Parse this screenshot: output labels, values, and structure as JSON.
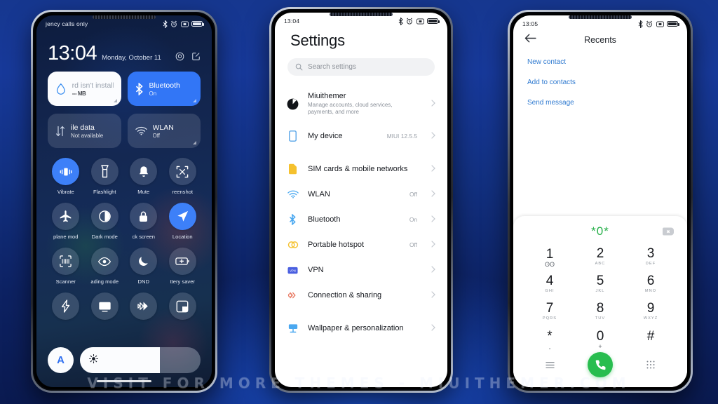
{
  "watermark": "VISIT FOR MORE THEMES - MIUITHEMER.COM",
  "background_color": "#123080",
  "phone1": {
    "name": "control-center",
    "status": {
      "carrier": "jency calls only",
      "icons": [
        "bluetooth-icon",
        "alarm-icon",
        "vibrate-icon",
        "battery-icon"
      ]
    },
    "clock": {
      "time": "13:04",
      "date": "Monday, October 11"
    },
    "header_icons": [
      "settings-gear-icon",
      "edit-icon"
    ],
    "big_tiles": [
      {
        "title": "rd isn't install",
        "sub": "--- MB",
        "state": "light",
        "icon": "water-drop-icon"
      },
      {
        "title": "Bluetooth",
        "sub": "On",
        "state": "on",
        "icon": "bluetooth-icon"
      },
      {
        "title": "ile data",
        "sub": "Not available",
        "state": "off",
        "icon": "mobile-data-icon"
      },
      {
        "title": "WLAN",
        "sub": "Off",
        "state": "off",
        "icon": "wifi-icon"
      }
    ],
    "toggles": [
      {
        "label": "Vibrate",
        "icon": "vibrate-icon",
        "active": true
      },
      {
        "label": "Flashlight",
        "icon": "flashlight-icon",
        "active": false
      },
      {
        "label": "Mute",
        "icon": "bell-icon",
        "active": false
      },
      {
        "label": "reenshot",
        "icon": "screenshot-icon",
        "active": false
      },
      {
        "label": "plane mod",
        "icon": "airplane-icon",
        "active": false
      },
      {
        "label": "Dark mode",
        "icon": "dark-mode-icon",
        "active": false
      },
      {
        "label": "ck screen",
        "icon": "lock-icon",
        "active": false
      },
      {
        "label": "Location",
        "icon": "location-icon",
        "active": true
      },
      {
        "label": "Scanner",
        "icon": "scanner-icon",
        "active": false
      },
      {
        "label": "ading mode",
        "icon": "eye-icon",
        "active": false
      },
      {
        "label": "DND",
        "icon": "moon-icon",
        "active": false
      },
      {
        "label": "ttery saver",
        "icon": "battery-saver-icon",
        "active": false
      },
      {
        "label": "",
        "icon": "lightning-icon",
        "active": false
      },
      {
        "label": "",
        "icon": "cast-screen-icon",
        "active": false
      },
      {
        "label": "",
        "icon": "sync-icon",
        "active": false
      },
      {
        "label": "",
        "icon": "split-screen-icon",
        "active": false
      }
    ],
    "brightness": {
      "auto_label": "A",
      "icon": "brightness-sun-icon",
      "level_percent": 66
    }
  },
  "phone2": {
    "name": "settings",
    "status": {
      "time": "13:04",
      "icons": [
        "bluetooth-icon",
        "alarm-icon",
        "vibrate-icon",
        "battery-icon"
      ]
    },
    "title": "Settings",
    "search": {
      "placeholder": "Search settings",
      "icon": "search-icon"
    },
    "account": {
      "name": "Miuithemer",
      "sub": "Manage accounts, cloud services, payments, and more",
      "icon": "account-avatar-icon"
    },
    "rows": [
      {
        "label": "My device",
        "value": "MIUI 12.5.5",
        "icon": "device-icon",
        "group": 1
      },
      {
        "label": "SIM cards & mobile networks",
        "value": "",
        "icon": "sim-card-icon",
        "group": 2
      },
      {
        "label": "WLAN",
        "value": "Off",
        "icon": "wifi-icon",
        "group": 2
      },
      {
        "label": "Bluetooth",
        "value": "On",
        "icon": "bluetooth-icon",
        "group": 2
      },
      {
        "label": "Portable hotspot",
        "value": "Off",
        "icon": "hotspot-icon",
        "group": 2
      },
      {
        "label": "VPN",
        "value": "",
        "icon": "vpn-icon",
        "group": 2
      },
      {
        "label": "Connection & sharing",
        "value": "",
        "icon": "connection-sharing-icon",
        "group": 2
      },
      {
        "label": "Wallpaper & personalization",
        "value": "",
        "icon": "wallpaper-icon",
        "group": 3
      }
    ]
  },
  "phone3": {
    "name": "dialer-recents",
    "status": {
      "time": "13:05",
      "icons": [
        "bluetooth-icon",
        "alarm-icon",
        "vibrate-icon",
        "battery-icon"
      ]
    },
    "title": "Recents",
    "back_icon": "back-arrow-icon",
    "actions": [
      "New contact",
      "Add to contacts",
      "Send message"
    ],
    "dialed_number": "*0*",
    "backspace_icon": "backspace-icon",
    "keys": [
      {
        "digit": "1",
        "sub": "ʘʘ",
        "sub_kind": "sym"
      },
      {
        "digit": "2",
        "sub": "ABC",
        "sub_kind": "txt"
      },
      {
        "digit": "3",
        "sub": "DEF",
        "sub_kind": "txt"
      },
      {
        "digit": "4",
        "sub": "GHI",
        "sub_kind": "txt"
      },
      {
        "digit": "5",
        "sub": "JKL",
        "sub_kind": "txt"
      },
      {
        "digit": "6",
        "sub": "MNO",
        "sub_kind": "txt"
      },
      {
        "digit": "7",
        "sub": "PQRS",
        "sub_kind": "txt"
      },
      {
        "digit": "8",
        "sub": "TUV",
        "sub_kind": "txt"
      },
      {
        "digit": "9",
        "sub": "WXYZ",
        "sub_kind": "txt"
      },
      {
        "digit": "*",
        "sub": ",",
        "sub_kind": "sym"
      },
      {
        "digit": "0",
        "sub": "+",
        "sub_kind": "sym"
      },
      {
        "digit": "#",
        "sub": "",
        "sub_kind": "sym"
      }
    ],
    "bottom": {
      "left_icon": "menu-list-icon",
      "call_icon": "call-icon",
      "right_icon": "keypad-icon"
    },
    "call_button_color": "#28bd4f",
    "number_color": "#27b04a"
  }
}
